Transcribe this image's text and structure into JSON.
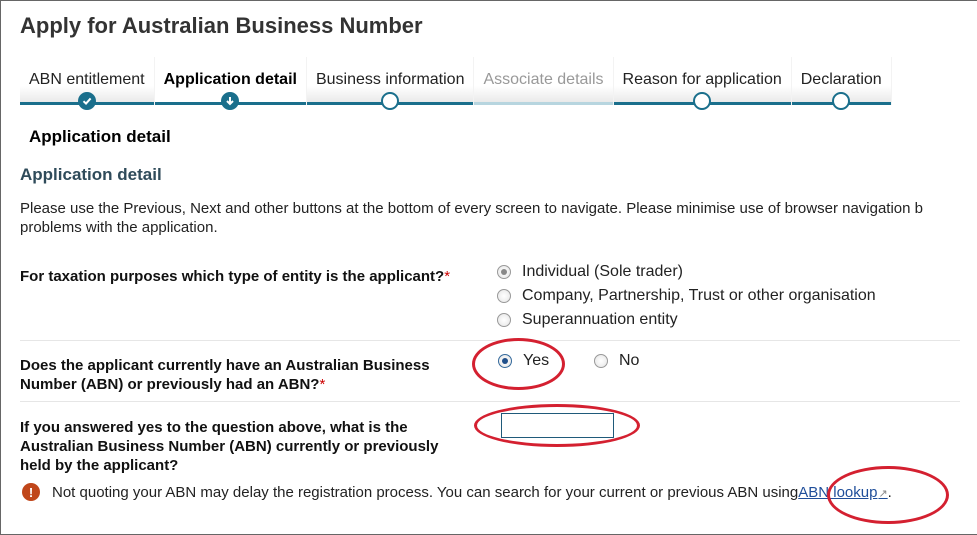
{
  "page": {
    "title": "Apply for Australian Business Number"
  },
  "steps": [
    {
      "label": "ABN entitlement",
      "state": "done"
    },
    {
      "label": "Application detail",
      "state": "current"
    },
    {
      "label": "Business information",
      "state": "todo"
    },
    {
      "label": "Associate details",
      "state": "disabled"
    },
    {
      "label": "Reason for application",
      "state": "todo"
    },
    {
      "label": "Declaration",
      "state": "todo"
    }
  ],
  "section": {
    "heading": "Application detail",
    "subheading": "Application detail",
    "intro_line1": "Please use the Previous, Next and other buttons at the bottom of every screen to navigate. Please minimise use of browser navigation b",
    "intro_line2": "problems with the application."
  },
  "entity_question": {
    "label": "For taxation purposes which type of entity is the applicant?",
    "required": "*",
    "options": [
      {
        "label": "Individual (Sole trader)",
        "selected": true
      },
      {
        "label": "Company, Partnership, Trust or other organisation",
        "selected": false
      },
      {
        "label": "Superannuation entity",
        "selected": false
      }
    ]
  },
  "abn_question": {
    "label_line1": "Does the applicant currently have an Australian Business",
    "label_line2": "Number (ABN) or previously had an ABN?",
    "required": "*",
    "options": [
      {
        "label": "Yes",
        "selected": true
      },
      {
        "label": "No",
        "selected": false
      }
    ]
  },
  "abn_number_question": {
    "label_line1": "If you answered yes to the question above, what is the",
    "label_line2": "Australian Business Number (ABN) currently or previously",
    "label_line3": "held by the applicant?",
    "value": ""
  },
  "notice": {
    "text": "Not quoting your ABN may delay the registration process. You can search for your current or previous ABN using ",
    "link_label": "ABN lookup",
    "suffix": "."
  },
  "colors": {
    "accent": "#1a6f8c",
    "annotation": "#d42030",
    "warning": "#c0461a"
  }
}
